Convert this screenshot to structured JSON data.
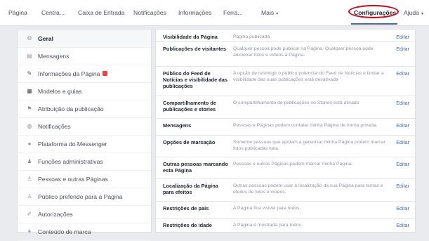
{
  "top_nav": {
    "items": [
      {
        "label": "Página"
      },
      {
        "label": "Centra..."
      },
      {
        "label": "Caixa de Entrada"
      },
      {
        "label": "Notificações"
      },
      {
        "label": "Informações"
      },
      {
        "label": "Ferra..."
      },
      {
        "label": "Mais",
        "caret": "▾"
      },
      {
        "label": "Configurações"
      },
      {
        "label": "Ajuda",
        "caret": "▾"
      }
    ],
    "active_index": 7,
    "accent_color": "#4267b2",
    "highlight_color": "#d9001b"
  },
  "sidebar": {
    "items": [
      {
        "label": "Geral",
        "icon": "gear-icon",
        "active": true
      },
      {
        "label": "Mensagens",
        "icon": "message-icon"
      },
      {
        "label": "Informações da Página",
        "icon": "pencil-icon",
        "badge": true
      },
      {
        "label": "Modelos e guias",
        "icon": "grid-icon"
      },
      {
        "label": "Atribuição da publicação",
        "icon": "flag-icon"
      },
      {
        "label": "Notificações",
        "icon": "globe-icon"
      },
      {
        "label": "Plataforma do Messenger",
        "icon": "messenger-icon"
      },
      {
        "label": "Funções administrativas",
        "icon": "person-icon"
      },
      {
        "label": "Pessoas e outras Páginas",
        "icon": "people-icon"
      },
      {
        "label": "Público preferido para a Página",
        "icon": "people-star-icon"
      },
      {
        "label": "Autorizações",
        "icon": "wrench-icon"
      },
      {
        "label": "Conteúdo de marca",
        "icon": "branded-content-icon"
      }
    ]
  },
  "settings": {
    "edit_label": "Editar",
    "rows": [
      {
        "label": "Visibilidade da Página",
        "desc": "Página publicada"
      },
      {
        "label": "Publicações de visitantes",
        "desc": "Qualquer pessoa pode publicar na Página. Qualquer pessoa pode adicionar fotos e vídeos à Página."
      },
      {
        "label": "Público do Feed de Notícias e visibilidade das publicações",
        "desc": "A opção de restringir o público potencial do Feed de Notícias e limitar a visibilidade das suas publicações está desativada"
      },
      {
        "label": "Compartilhamento de publicações e stories",
        "desc": "O compartilhamento de publicações no Stories está ativado"
      },
      {
        "label": "Mensagens",
        "desc": "Pessoas e Páginas podem contatar minha Página de forma privada."
      },
      {
        "label": "Opções de marcação",
        "desc": "Somente pessoas que ajudam a gerenciar minha Página podem marcar fotos publicadas nela."
      },
      {
        "label": "Outras pessoas marcando esta Página",
        "desc": "Pessoas e outras Páginas podem marcar minha Página."
      },
      {
        "label": "Localização da Página para efeitos",
        "desc": "Outras pessoas podem usar a localização da sua Página para temas e efeitos de fotos e vídeos."
      },
      {
        "label": "Restrições de país",
        "desc": "A Página fica visível para todos."
      },
      {
        "label": "Restrições de idade",
        "desc": "A Página é mostrada para todos."
      }
    ]
  }
}
